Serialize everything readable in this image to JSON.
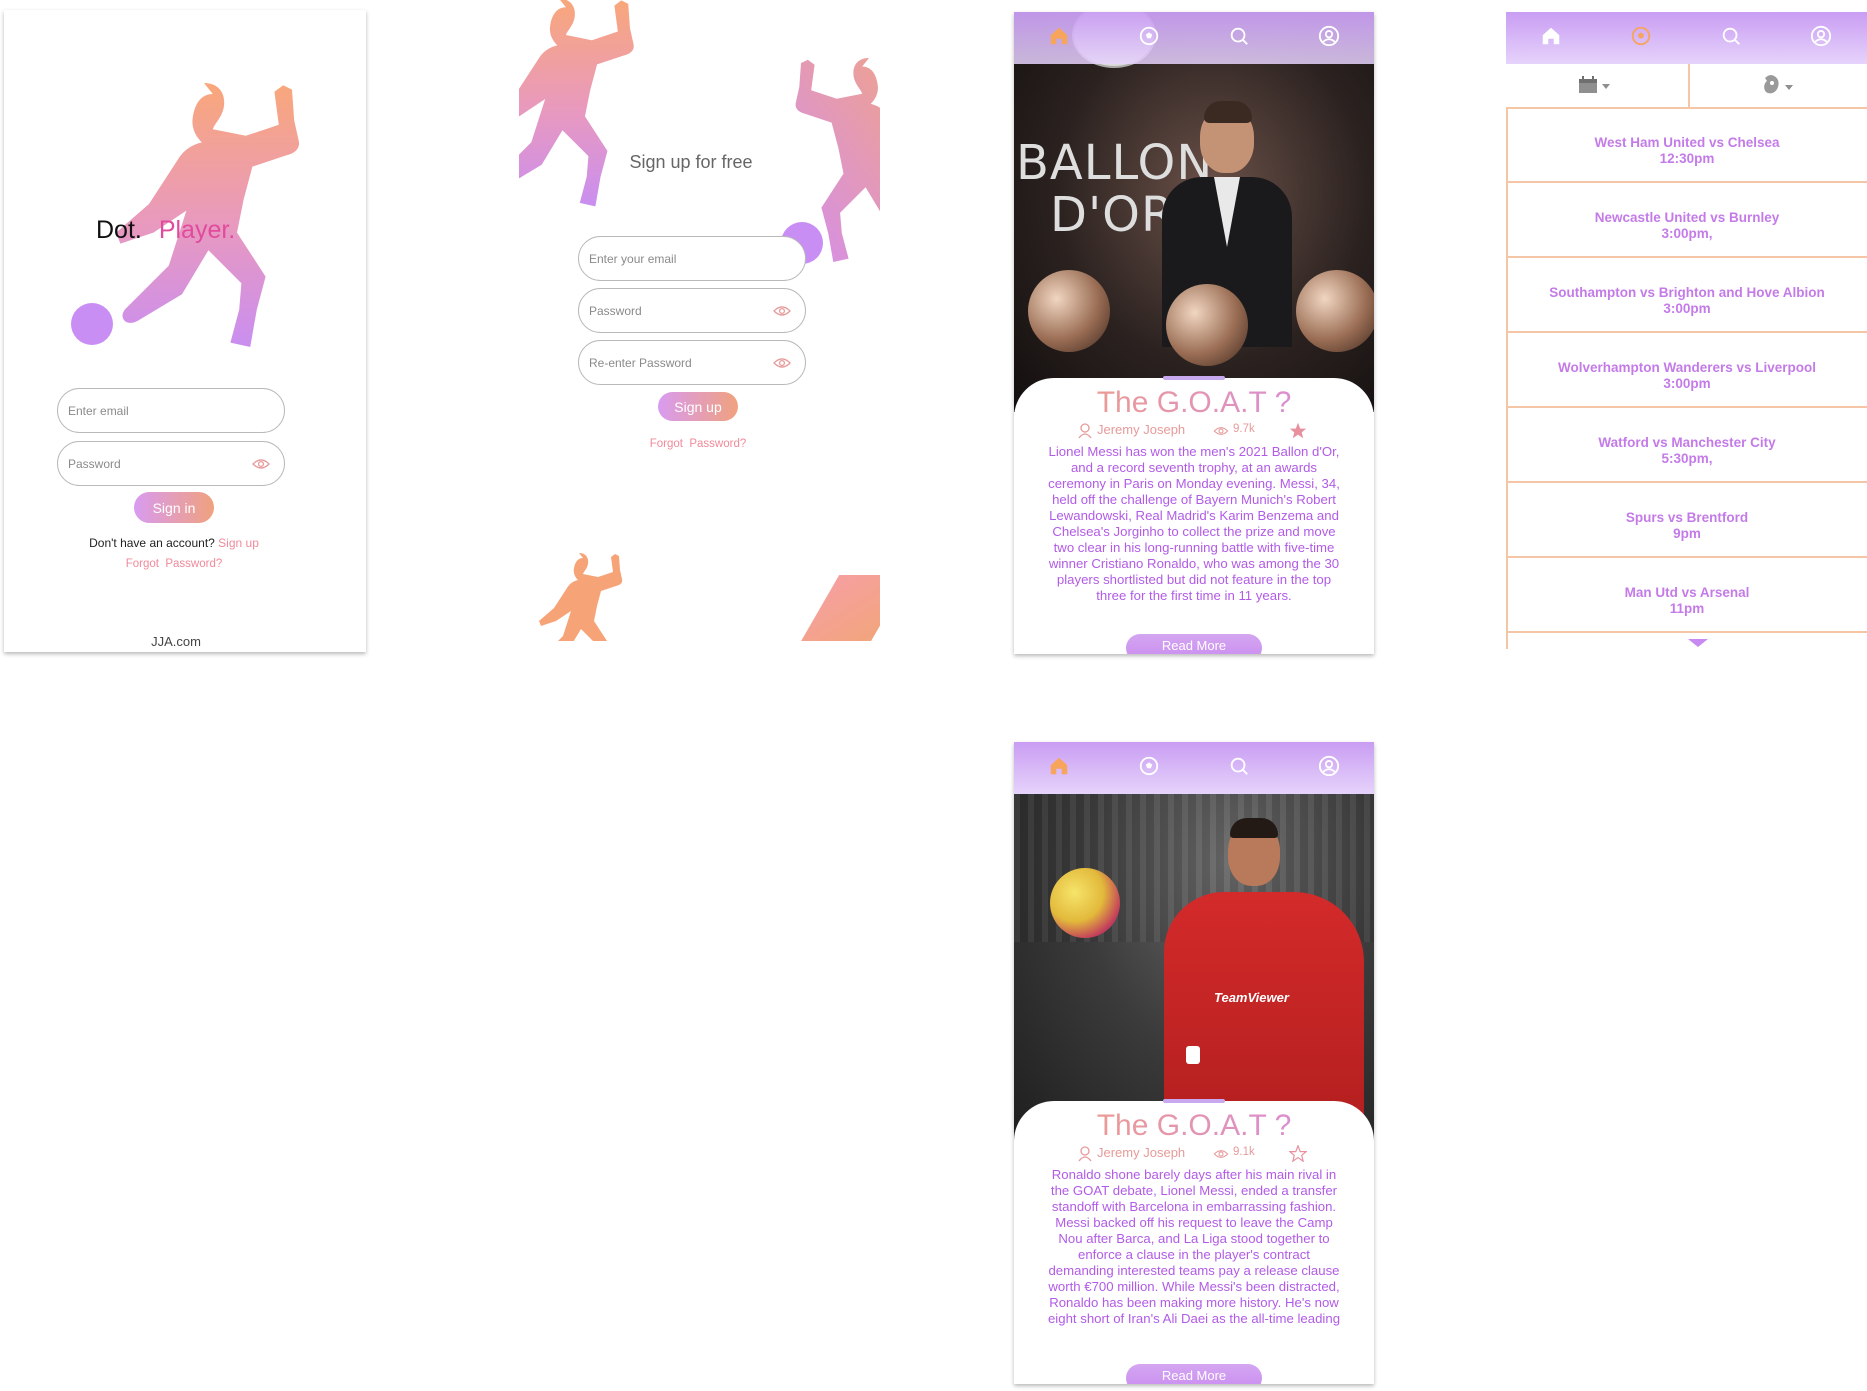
{
  "login": {
    "brand_word1": "Dot.",
    "brand_word2": "Player.",
    "email_placeholder": "Enter email",
    "password_placeholder": "Password",
    "signin_label": "Sign in",
    "no_account_text": "Don't have an account?",
    "signup_link": "Sign up",
    "forgot_link": "Forgot  Password?",
    "footer": "JJA.com"
  },
  "signup": {
    "heading": "Sign up for free",
    "email_placeholder": "Enter your email",
    "password_placeholder": "Password",
    "reenter_placeholder": "Re-enter Password",
    "signup_label": "Sign up",
    "forgot_link": "Forgot  Password?"
  },
  "nav": {
    "icons": [
      "home-icon",
      "football-icon",
      "search-icon",
      "profile-icon"
    ],
    "active_color": "#f7a45c",
    "inactive_color": "#ffffff"
  },
  "article_messi": {
    "title": "The G.O.A.T ?",
    "author": "Jeremy Joseph",
    "views": "9.7k",
    "favorited": true,
    "body": "Lionel Messi has won the men's 2021 Ballon d'Or, and a record seventh trophy, at an awards ceremony in Paris on Monday evening. Messi, 34, held off the challenge of Bayern Munich's Robert Lewandowski, Real Madrid's Karim Benzema and Chelsea's Jorginho to collect the prize and move two clear in his long-running battle with five-time winner Cristiano Ronaldo, who was among the 30 players shortlisted but did not feature in the top three for the first time in 11 years.",
    "read_more": "Read More",
    "photo_text_line1": "BALLON",
    "photo_text_line2": "D'OR"
  },
  "article_ronaldo": {
    "title": "The G.O.A.T ?",
    "author": "Jeremy Joseph",
    "views": "9.1k",
    "favorited": false,
    "body": "Ronaldo shone barely days after his main rival in the GOAT debate, Lionel Messi, ended a transfer standoff with Barcelona in embarrassing fashion. Messi backed off his request to leave the Camp Nou after Barca, and La Liga stood together to enforce a clause in the player's contract demanding interested teams pay a release clause worth €700 million. While Messi's been distracted, Ronaldo has been making more history. He's now eight short of Iran's Ali Daei as the all-time leading",
    "read_more": "Read More",
    "jersey_text": "TeamViewer"
  },
  "fixtures": {
    "filter_icons": [
      "calendar-icon",
      "league-icon"
    ],
    "matches": [
      {
        "teams": "West Ham United vs Chelsea",
        "time": "12:30pm"
      },
      {
        "teams": "Newcastle United vs Burnley",
        "time": "3:00pm,"
      },
      {
        "teams": "Southampton vs Brighton and Hove Albion",
        "time": "3:00pm"
      },
      {
        "teams": "Wolverhampton Wanderers vs Liverpool",
        "time": "3:00pm"
      },
      {
        "teams": "Watford vs Manchester City",
        "time": "5:30pm,"
      },
      {
        "teams": "Spurs vs Brentford",
        "time": "9pm"
      },
      {
        "teams": "Man Utd vs Arsenal",
        "time": "11pm"
      }
    ]
  },
  "colors": {
    "accent_orange": "#f2a07a",
    "accent_purple": "#d489ea",
    "text_purple": "#b25be6",
    "divider_peach": "#f5c6a6"
  }
}
